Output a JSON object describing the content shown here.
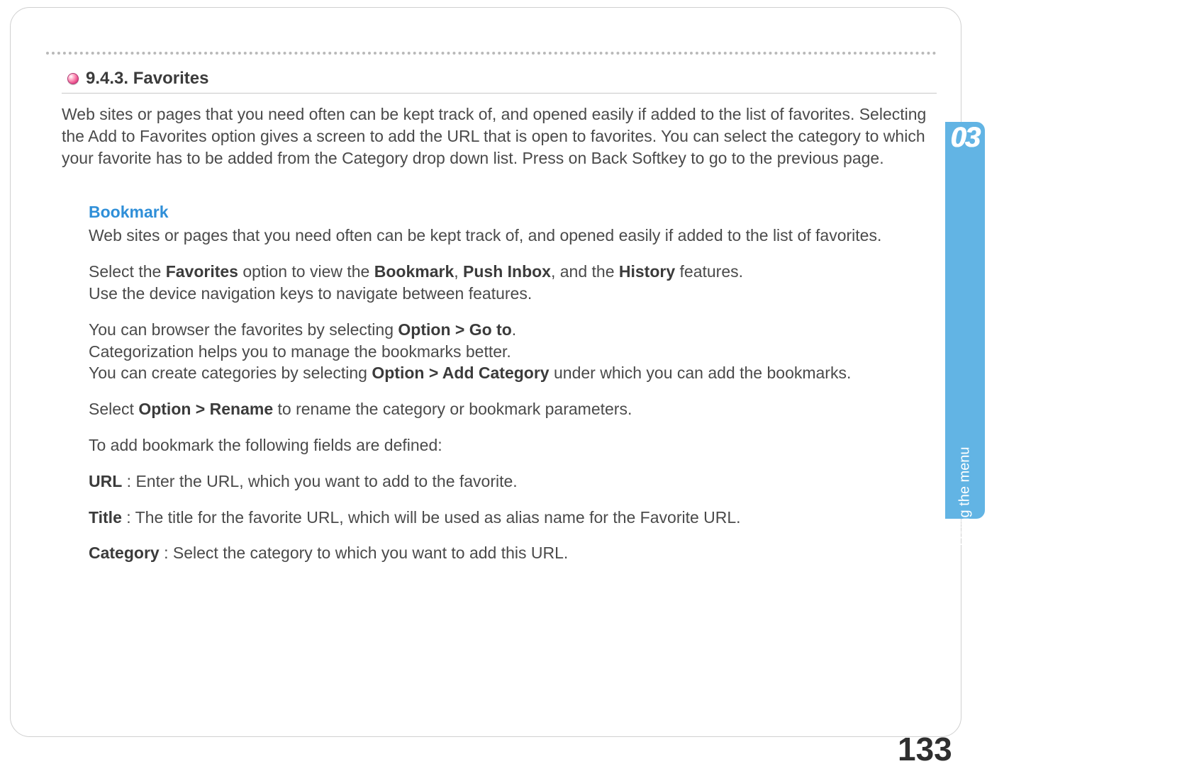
{
  "section": {
    "number_title": "9.4.3. Favorites",
    "intro": "Web sites or pages that you need often can be kept track of, and opened easily if added to the list of favorites.  Selecting the Add to Favorites option gives a screen to add the URL that is open to favorites. You can select the category to which your favorite has to be added from the Category drop down list. Press on Back Softkey to go to the previous page."
  },
  "bookmark": {
    "heading": "Bookmark",
    "p1": "Web sites or pages that you need often can be kept track of, and opened easily if added to the list of favorites.",
    "p2_a": "Select the ",
    "p2_b1": "Favorites",
    "p2_c": " option to view the ",
    "p2_b2": "Bookmark",
    "p2_d": ", ",
    "p2_b3": "Push Inbox",
    "p2_e": ", and the ",
    "p2_b4": "History",
    "p2_f": " features.",
    "p2_line2": "Use the device navigation keys to navigate between features.",
    "p3_a": "You can browser the favorites by selecting ",
    "p3_b1": "Option > Go to",
    "p3_c": ".",
    "p3_line2": "Categorization helps you to manage the bookmarks better.",
    "p3_d": "You can create categories by selecting ",
    "p3_b2": "Option > Add Category",
    "p3_e": " under which you can add the bookmarks.",
    "p4_a": "Select ",
    "p4_b1": "Option > Rename",
    "p4_c": " to rename the category or bookmark parameters.",
    "p5": "To add bookmark the following fields are defined:",
    "f1_label": "URL",
    "f1_text": " : Enter the URL, which you want to add to the favorite.",
    "f2_label": "Title",
    "f2_text": " : The title for the favorite URL, which will be used as alias name for the Favorite URL.",
    "f3_label": "Category",
    "f3_text": " : Select the category to which you want to add this URL."
  },
  "sidebar": {
    "chapter_number": "03",
    "label": "Using the menu"
  },
  "page_number": "133"
}
